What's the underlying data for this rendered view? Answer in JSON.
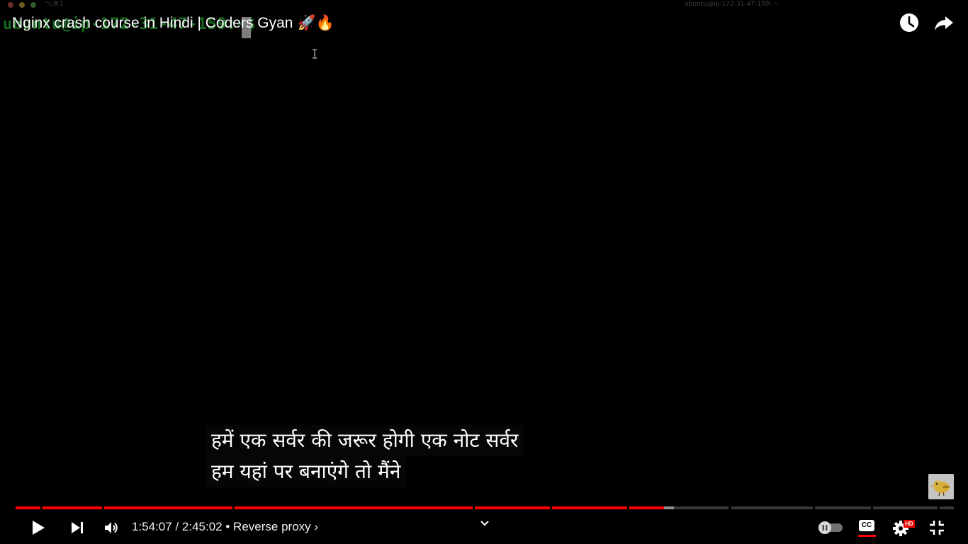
{
  "terminal": {
    "shortcut": "⌥⌘1",
    "window_title": "ubuntu@ip-172-31-47-159: ~",
    "prompt": "ubuntu@ip-172-31-47-159:~$ "
  },
  "video": {
    "title": "Nginx crash course in Hindi | Coders Gyan",
    "title_emoji": "🚀🔥"
  },
  "captions": {
    "line1": "हमें एक सर्वर की जरूर होगी एक नोट सर्वर",
    "line2": "हम यहां पर बनाएंगे तो मैंने"
  },
  "player": {
    "current_time": "1:54:07",
    "separator": " / ",
    "duration": "2:45:02",
    "chapter_dot": " • ",
    "chapter": "Reverse proxy",
    "chapter_chevron": "›",
    "cc_label": "CC",
    "hd_label": "HD",
    "played_fraction": 0.691,
    "loaded_fraction": 0.702,
    "segments": [
      38,
      93,
      198,
      368,
      117,
      116,
      154,
      127,
      86,
      100,
      22
    ],
    "accent": "#ff0000"
  }
}
